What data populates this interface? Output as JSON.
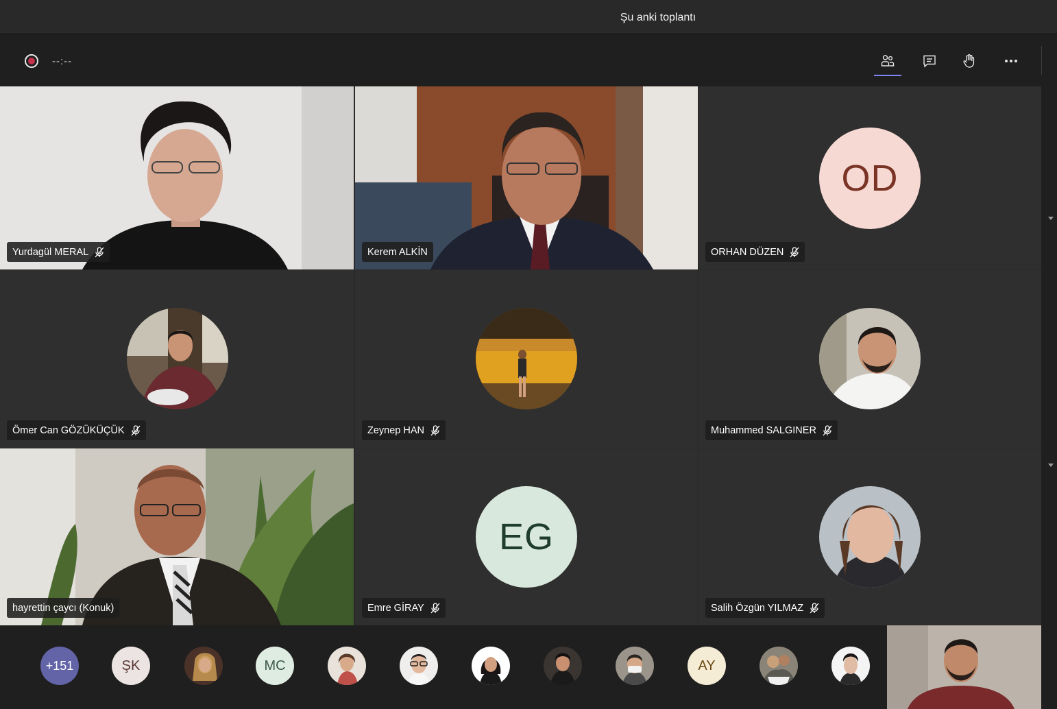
{
  "window": {
    "title": "Şu anki toplantı"
  },
  "toolbar": {
    "timer": "--:--",
    "buttons": [
      {
        "icon": "participants-icon",
        "active": true
      },
      {
        "icon": "chat-icon",
        "active": false
      },
      {
        "icon": "raise-hand-icon",
        "active": false
      },
      {
        "icon": "more-options-icon",
        "active": false
      }
    ]
  },
  "participants": [
    {
      "name": "Yurdagül MERAL",
      "muted": true,
      "kind": "video"
    },
    {
      "name": "Kerem ALKİN",
      "muted": false,
      "kind": "video"
    },
    {
      "name": "ORHAN DÜZEN",
      "muted": true,
      "kind": "initials",
      "initials": "OD",
      "bg": "#f7d9d4",
      "fg": "#7a3426"
    },
    {
      "name": "Ömer Can GÖZÜKÜÇÜK",
      "muted": true,
      "kind": "photo"
    },
    {
      "name": "Zeynep HAN",
      "muted": true,
      "kind": "photo"
    },
    {
      "name": "Muhammed SALGINER",
      "muted": true,
      "kind": "photo"
    },
    {
      "name": "hayrettin çaycı (Konuk)",
      "muted": false,
      "kind": "video"
    },
    {
      "name": "Emre GİRAY",
      "muted": true,
      "kind": "initials",
      "initials": "EG",
      "bg": "#d9e8dd",
      "fg": "#1f3d2b"
    },
    {
      "name": "Salih Özgün YILMAZ",
      "muted": true,
      "kind": "photo"
    }
  ],
  "roster": {
    "overflow_count": "+151",
    "initials": [
      {
        "text": "ŞK",
        "bg": "#ece4e2",
        "fg": "#5a3a35"
      },
      {
        "text": "MC",
        "bg": "#dfece2",
        "fg": "#3c5a45"
      },
      {
        "text": "AY",
        "bg": "#f5ecd6",
        "fg": "#6b4a12"
      }
    ]
  },
  "colors": {
    "accent": "#7f85f5",
    "record": "#c4314b",
    "overflow_bg": "#6264a7"
  }
}
